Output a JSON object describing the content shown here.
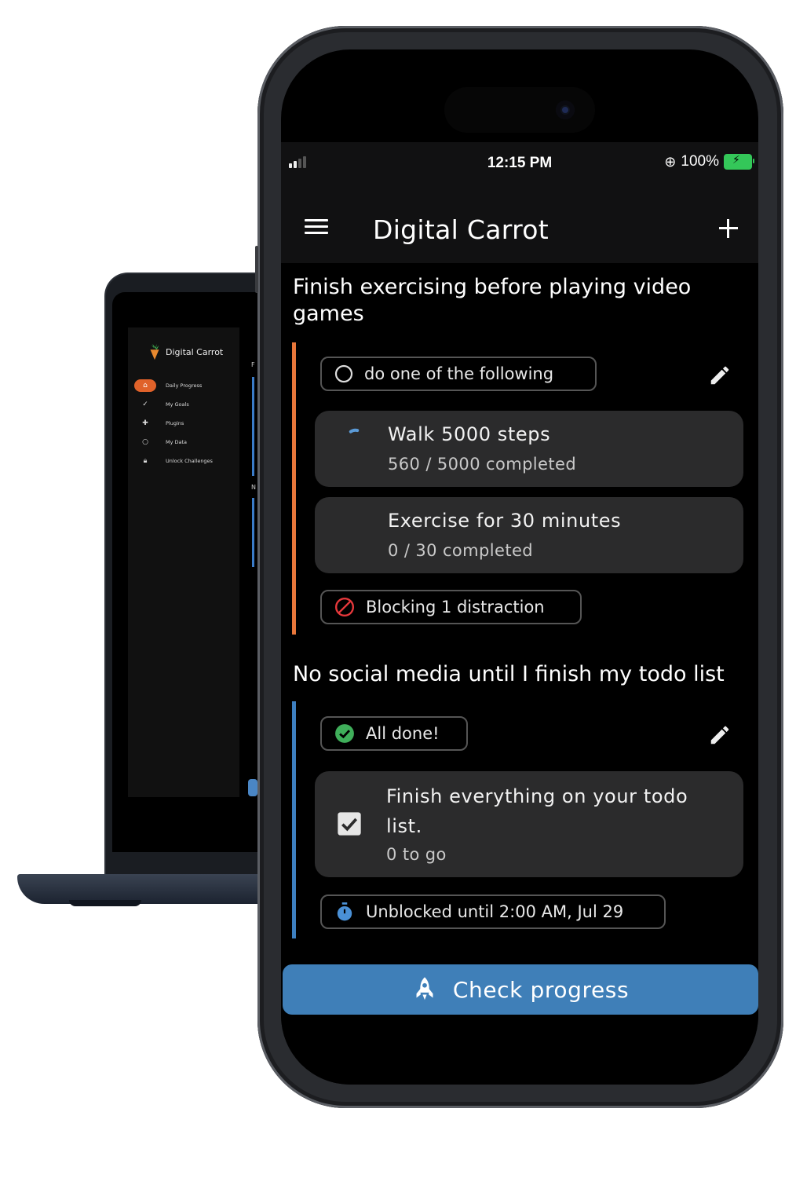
{
  "laptop": {
    "app_name": "Digital Carrot",
    "nav": [
      {
        "label": "Daily Progress",
        "icon": "home-icon"
      },
      {
        "label": "My Goals",
        "icon": "check-icon"
      },
      {
        "label": "Plugins",
        "icon": "puzzle-icon"
      },
      {
        "label": "My Data",
        "icon": "circle-icon"
      },
      {
        "label": "Unlock Challenges",
        "icon": "lock-icon"
      }
    ],
    "right_fragments": [
      "F",
      "N"
    ]
  },
  "status_bar": {
    "time": "12:15 PM",
    "battery": "100%"
  },
  "app_bar": {
    "title": "Digital Carrot"
  },
  "goals": [
    {
      "title": "Finish exercising before playing video games",
      "accent": "#e8763a",
      "condition": "do one of the following",
      "tasks": [
        {
          "title": "Walk 5000 steps",
          "progress_text": "560 / 5000 completed",
          "progress": 0.112
        },
        {
          "title": "Exercise for 30 minutes",
          "progress_text": "0 / 30 completed",
          "progress": 0
        }
      ],
      "block_status": "Blocking 1 distraction",
      "block_color": "#e5383b"
    },
    {
      "title": "No social media until I finish my todo list",
      "accent": "#3d7fc0",
      "condition": "All done!",
      "condition_color": "#3fae5a",
      "tasks": [
        {
          "title_line1": "Finish everything on your todo",
          "title_line2": "list.",
          "progress_text": "0 to go",
          "checked": true
        }
      ],
      "block_status": "Unblocked until 2:00 AM, Jul 29",
      "block_color": "#4a90d6"
    }
  ],
  "footer": {
    "check_progress_label": "Check progress",
    "button_color": "#3f7fb8"
  }
}
